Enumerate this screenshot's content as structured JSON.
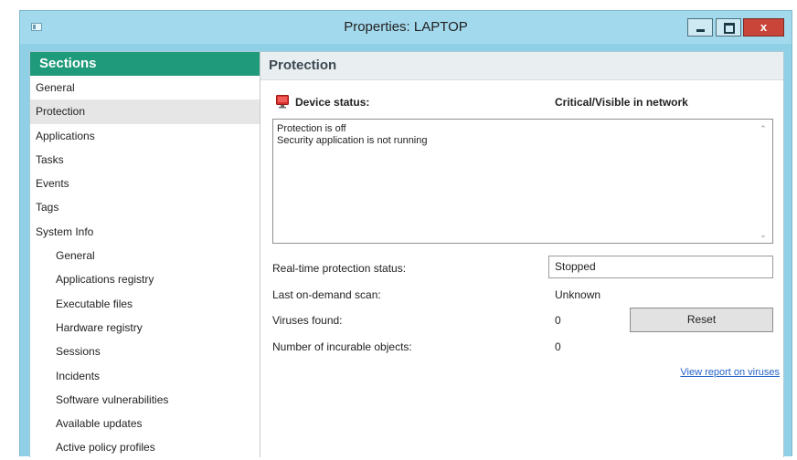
{
  "window": {
    "title": "Properties: LAPTOP",
    "close_glyph": "x"
  },
  "sidebar": {
    "header": "Sections",
    "items": [
      {
        "label": "General",
        "level": 0,
        "selected": false
      },
      {
        "label": "Protection",
        "level": 0,
        "selected": true
      },
      {
        "label": "Applications",
        "level": 0,
        "selected": false
      },
      {
        "label": "Tasks",
        "level": 0,
        "selected": false
      },
      {
        "label": "Events",
        "level": 0,
        "selected": false
      },
      {
        "label": "Tags",
        "level": 0,
        "selected": false
      },
      {
        "label": "System Info",
        "level": 0,
        "selected": false
      },
      {
        "label": "General",
        "level": 1,
        "selected": false
      },
      {
        "label": "Applications registry",
        "level": 1,
        "selected": false
      },
      {
        "label": "Executable files",
        "level": 1,
        "selected": false
      },
      {
        "label": "Hardware registry",
        "level": 1,
        "selected": false
      },
      {
        "label": "Sessions",
        "level": 1,
        "selected": false
      },
      {
        "label": "Incidents",
        "level": 1,
        "selected": false
      },
      {
        "label": "Software vulnerabilities",
        "level": 1,
        "selected": false
      },
      {
        "label": "Available updates",
        "level": 1,
        "selected": false
      },
      {
        "label": "Active policy profiles",
        "level": 1,
        "selected": false
      }
    ]
  },
  "protection": {
    "header": "Protection",
    "device_status_label": "Device status:",
    "device_status_value": "Critical/Visible in network",
    "status_lines": [
      "Protection is off",
      "Security application is not running"
    ],
    "realtime_label": "Real-time protection status:",
    "realtime_value": "Stopped",
    "last_scan_label": "Last on-demand scan:",
    "last_scan_value": "Unknown",
    "viruses_label": "Viruses found:",
    "viruses_value": "0",
    "reset_label": "Reset",
    "incurable_label": "Number of incurable objects:",
    "incurable_value": "0",
    "report_link": "View report on viruses"
  },
  "colors": {
    "sections_header": "#1f9a7a",
    "window_frame": "#8fd0e6",
    "close_button": "#c9453a",
    "device_icon": "#d9302c",
    "link": "#2563c7"
  }
}
